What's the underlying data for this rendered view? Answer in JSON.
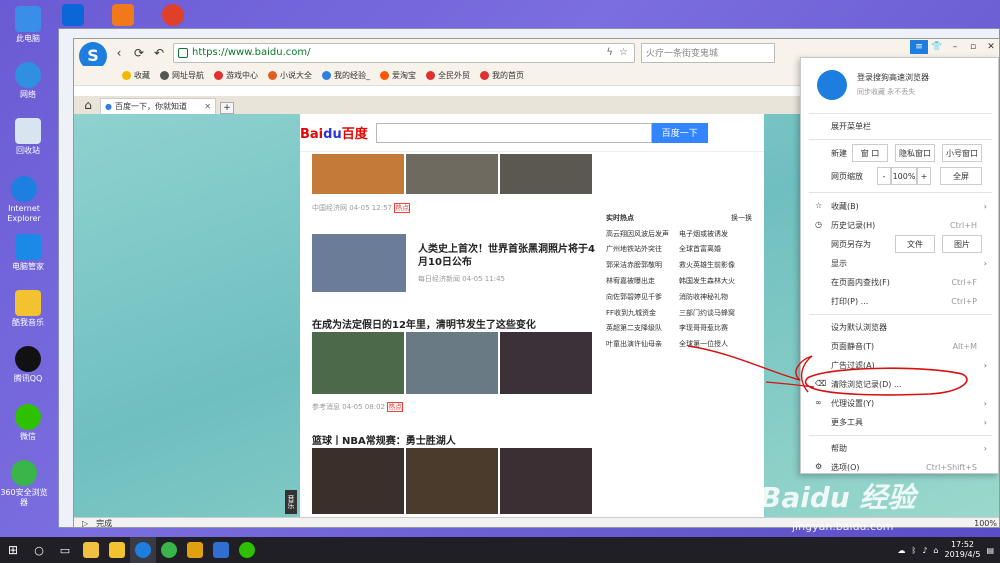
{
  "desktop": {
    "icons": [
      {
        "label": "此电脑",
        "color": "#3b8ee8"
      },
      {
        "label": "网络",
        "color": "#2f8fe0"
      },
      {
        "label": "回收站",
        "color": "#d8e4f0"
      },
      {
        "label": "Internet Explorer",
        "color": "#1d7fe0"
      },
      {
        "label": "电脑管家",
        "color": "#1a8ae6"
      },
      {
        "label": "酷我音乐",
        "color": "#f2c230"
      },
      {
        "label": "腾讯QQ",
        "color": "#111111"
      },
      {
        "label": "微信",
        "color": "#2dc100"
      },
      {
        "label": "360安全浏览器",
        "color": "#39b54a"
      }
    ],
    "top_icons": [
      {
        "name": "windows-store-icon",
        "color": "#0b66d8"
      },
      {
        "name": "music-app-icon",
        "color": "#f07a1a"
      },
      {
        "name": "bee-app-icon",
        "color": "#e0402a"
      }
    ]
  },
  "browser": {
    "url": "https://www.baidu.com/",
    "search_placeholder": "火疗一条街变鬼城",
    "bookmarks": [
      {
        "label": "收藏",
        "color": "#f5b800"
      },
      {
        "label": "网址导航",
        "color": "#555555"
      },
      {
        "label": "游戏中心",
        "color": "#e03030"
      },
      {
        "label": "小说大全",
        "color": "#e06020"
      },
      {
        "label": "我的经验_",
        "color": "#2f7fe0"
      },
      {
        "label": "爱淘宝",
        "color": "#ff5500"
      },
      {
        "label": "全民外贸",
        "color": "#e03030"
      },
      {
        "label": "我的首页",
        "color": "#e03030"
      }
    ],
    "tab_title": "百度一下，你就知道",
    "status": "完成",
    "zoom": "100%"
  },
  "baidu": {
    "logo_a": "Bai",
    "logo_b": "du",
    "logo_c": "百度",
    "button": "百度一下",
    "news": [
      {
        "source": "中国经济网",
        "time": "04-05 12:57",
        "tag": "热点"
      },
      {
        "title": "人类史上首次！世界首张黑洞照片将于4月10日公布",
        "source": "每日经济新闻",
        "time": "04-05 11:45"
      },
      {
        "title": "在成为法定假日的12年里，清明节发生了这些变化",
        "source": "参考消息",
        "time": "04-05 08:02",
        "tag": "热点"
      },
      {
        "title": "篮球丨NBA常规赛：勇士胜湖人"
      }
    ],
    "hot": {
      "title": "实时热点",
      "refresh": "换一换",
      "items": [
        [
          "高云翔因风波后发声",
          "电子烟或被诱发"
        ],
        [
          "广州地铁站外突往",
          "全球首富离婚"
        ],
        [
          "郭采洁赤膀郭敬明",
          "救火英雄生前影像"
        ],
        [
          "林宥嘉被曝出走",
          "韩国发生森林大火"
        ],
        [
          "向佐郭碧婷见千爹",
          "消防收神秘礼物"
        ],
        [
          "FF收到九城资金",
          "三部门约谈马蜂窝"
        ],
        [
          "英超第二支降级队",
          "李现哥哥惹比赛"
        ],
        [
          "叶童出演许仙母亲",
          "全球第一位授人"
        ]
      ]
    },
    "side_label": "音乐"
  },
  "menu": {
    "login": "登录搜狗高速浏览器",
    "login_sub": "同步收藏 永不丢失",
    "expand": "展开菜单栏",
    "new_label": "新建",
    "new_window": "窗 口",
    "private": "隐私窗口",
    "small": "小号窗口",
    "zoom_label": "网页缩放",
    "minus": "-",
    "zoom": "100%",
    "plus": "+",
    "fullscreen": "全屏",
    "favorites": "收藏(B)",
    "history": "历史记录(H)",
    "history_sc": "Ctrl+H",
    "saveas": "网页另存为",
    "file": "文件",
    "image": "图片",
    "display": "显示",
    "find": "在页面内查找(F)",
    "find_sc": "Ctrl+F",
    "print": "打印(P) ...",
    "print_sc": "Ctrl+P",
    "default": "设为默认浏览器",
    "mute": "页面静音(T)",
    "mute_sc": "Alt+M",
    "adfilter": "广告过滤(A)",
    "clear": "清除浏览记录(D) ...",
    "proxy": "代理设置(Y)",
    "tools": "更多工具",
    "help": "帮助",
    "options": "选项(O)",
    "options_sc": "Ctrl+Shift+S"
  },
  "watermark": {
    "main": "Baidu 经验",
    "url": "jingyan.baidu.com"
  },
  "taskbar": {
    "time": "17:52",
    "date": "2019/4/5",
    "apps": [
      {
        "name": "file-explorer-icon",
        "color": "#f0c040"
      },
      {
        "name": "kuwo-icon",
        "color": "#f2c230"
      },
      {
        "name": "sogou-browser-icon",
        "color": "#1e7ee0"
      },
      {
        "name": "360-icon",
        "color": "#39b54a"
      },
      {
        "name": "g-app-icon",
        "color": "#e0a010"
      },
      {
        "name": "book-app-icon",
        "color": "#2f6fd0"
      },
      {
        "name": "wechat-icon",
        "color": "#2dc100"
      }
    ]
  },
  "annotation_color": "#d81010"
}
